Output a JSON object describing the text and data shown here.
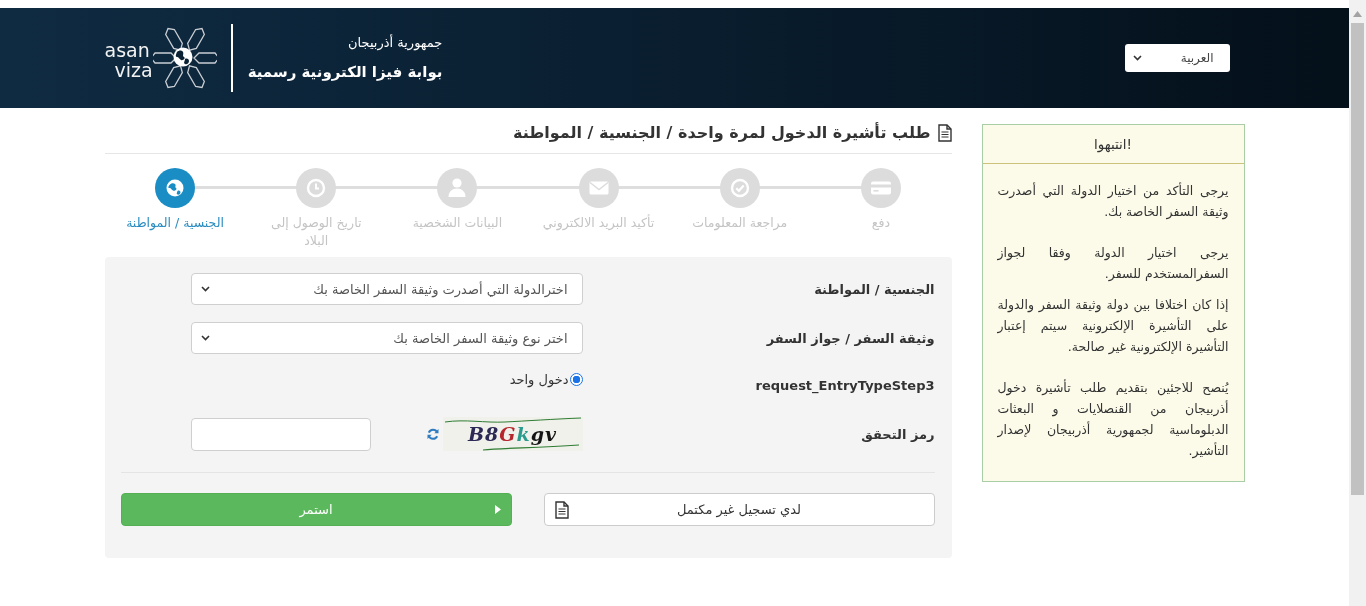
{
  "header": {
    "logo": {
      "line_1": "asan",
      "line_2": "viza"
    },
    "subtitle": "جمهورية أذربيجان",
    "title": "بوابة فيزا الكترونية رسمية",
    "language_select": {
      "value": "العربية"
    }
  },
  "page_title": "طلب تأشيرة الدخول لمرة واحدة / الجنسية / المواطنة",
  "steps": [
    {
      "label": "دفع",
      "selected": false
    },
    {
      "label": "مراجعة المعلومات",
      "selected": false
    },
    {
      "label": "تأكيد البريد الالكتروني",
      "selected": false
    },
    {
      "label": "البيانات الشخصية",
      "selected": false
    },
    {
      "label": "تاريخ الوصول إلى البلاد",
      "selected": false
    },
    {
      "label": "الجنسية / المواطنة",
      "selected": true
    }
  ],
  "form": {
    "fields": [
      {
        "kind": "select",
        "label": "الجنسية / المواطنة",
        "placeholder": "اخترالدولة التي أصدرت وثيقة السفر الخاصة بك"
      },
      {
        "kind": "select",
        "label": "وثيقة السفر / جواز السفر",
        "placeholder": "اختر نوع وثيقة السفر الخاصة بك"
      },
      {
        "kind": "radio",
        "label": "request_EntryTypeStep3",
        "options": [
          {
            "label": "دخول واحد",
            "selected": true
          }
        ]
      },
      {
        "kind": "captcha",
        "label": "رمز التحقق",
        "captcha_text": "B8Gkgv"
      }
    ],
    "buttons": [
      {
        "kind": "secondary",
        "label": "لدي تسجيل غير مكتمل"
      },
      {
        "kind": "primary",
        "label": "استمر"
      }
    ]
  },
  "notice": {
    "title": "انتبهوا!",
    "paragraphs": [
      "يرجى التأكد من اختيار الدولة التي أصدرت وثيقة السفر الخاصة بك.",
      "يرجى اختيار الدولة وفقا لجواز السفرالمستخدم للسفر.",
      "إذا كان اختلافا بين دولة وثيقة السفر والدولة على التأشيرة الإلكترونية سيتم إعتبار التأشيرة الإلكترونية غير صالحة.",
      "يُنصح للاجئين بتقديم طلب تأشيرة دخول أذربيجان من القنصلايات و البعثات الدبلوماسية لجمهورية أذربيجان لإصدار التأشير."
    ]
  }
}
